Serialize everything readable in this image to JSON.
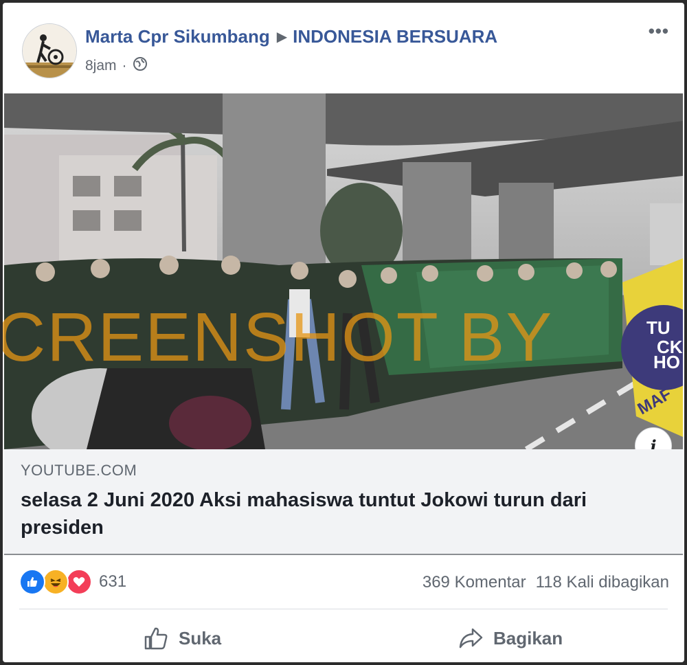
{
  "post": {
    "author": "Marta Cpr Sikumbang",
    "group": "INDONESIA BERSUARA",
    "time": "8jam",
    "more_label": "•••"
  },
  "media": {
    "watermark": "CREENSHOT BY",
    "banner_text": [
      "TU",
      "CK",
      "HO",
      "MAF"
    ],
    "info_label": "i"
  },
  "link": {
    "domain": "YOUTUBE.COM",
    "title": "selasa 2 Juni 2020 Aksi mahasiswa tuntut Jokowi turun dari presiden"
  },
  "reactions": {
    "icons": [
      "like-icon",
      "haha-icon",
      "love-icon"
    ],
    "count": "631",
    "comments": "369 Komentar",
    "shares": "118 Kali dibagikan"
  },
  "actions": {
    "like": "Suka",
    "share": "Bagikan"
  },
  "colors": {
    "author_blue": "#385898",
    "like_blue": "#1877f2",
    "love_red": "#f33e58",
    "haha_yellow": "#f7b125"
  }
}
